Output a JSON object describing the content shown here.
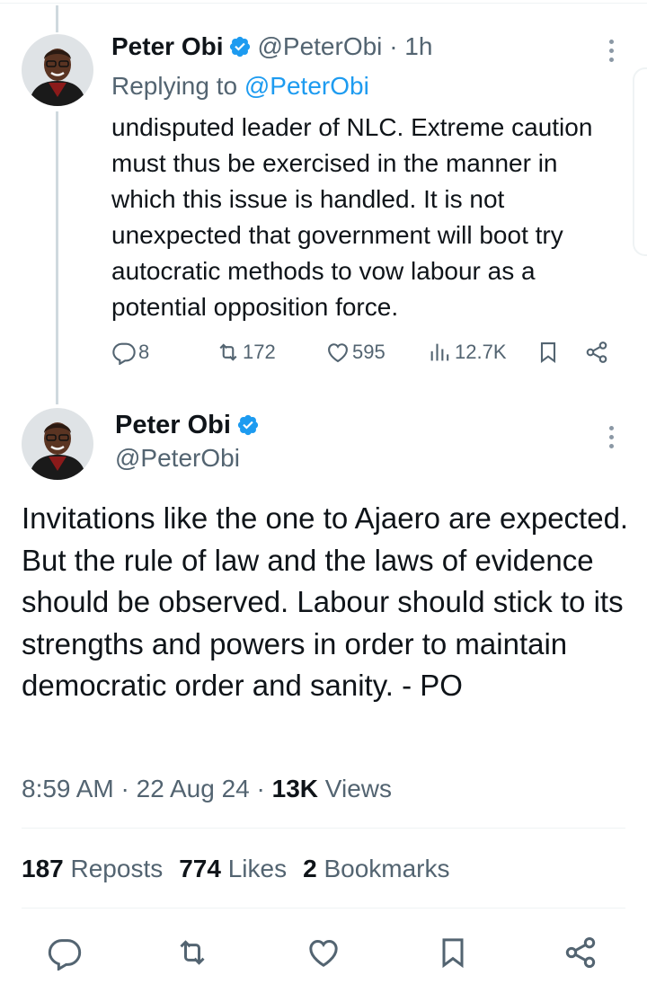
{
  "reply_tweet": {
    "name": "Peter Obi",
    "handle": "@PeterObi",
    "separator": "·",
    "time": "1h",
    "replying_prefix": "Replying to",
    "replying_to": "@PeterObi",
    "text": "undisputed leader of NLC. Extreme caution must thus be exercised in the manner in which this issue is handled. It is not unexpected that government will boot try autocratic methods to vow labour as a potential opposition force.",
    "replies": "8",
    "reposts": "172",
    "likes": "595",
    "views": "12.7K"
  },
  "main_tweet": {
    "name": "Peter Obi",
    "handle": "@PeterObi",
    "text": "Invitations like the one to Ajaero are expected. But the rule of law and the laws of evidence should be observed. Labour should stick to its strengths and powers in order to maintain democratic order and sanity. - PO",
    "time": "8:59 AM",
    "date": "22 Aug 24",
    "separator": "·",
    "views_count": "13K",
    "views_label": "Views",
    "reposts_count": "187",
    "reposts_label": "Reposts",
    "likes_count": "774",
    "likes_label": "Likes",
    "bookmarks_count": "2",
    "bookmarks_label": "Bookmarks"
  },
  "colors": {
    "accent": "#1d9bf0",
    "muted": "#536471",
    "text": "#0f1419",
    "divider": "#eff3f4"
  },
  "icons": [
    "verified-badge-icon",
    "more-options-icon",
    "reply-icon",
    "repost-icon",
    "like-icon",
    "views-icon",
    "bookmark-icon",
    "share-icon"
  ]
}
